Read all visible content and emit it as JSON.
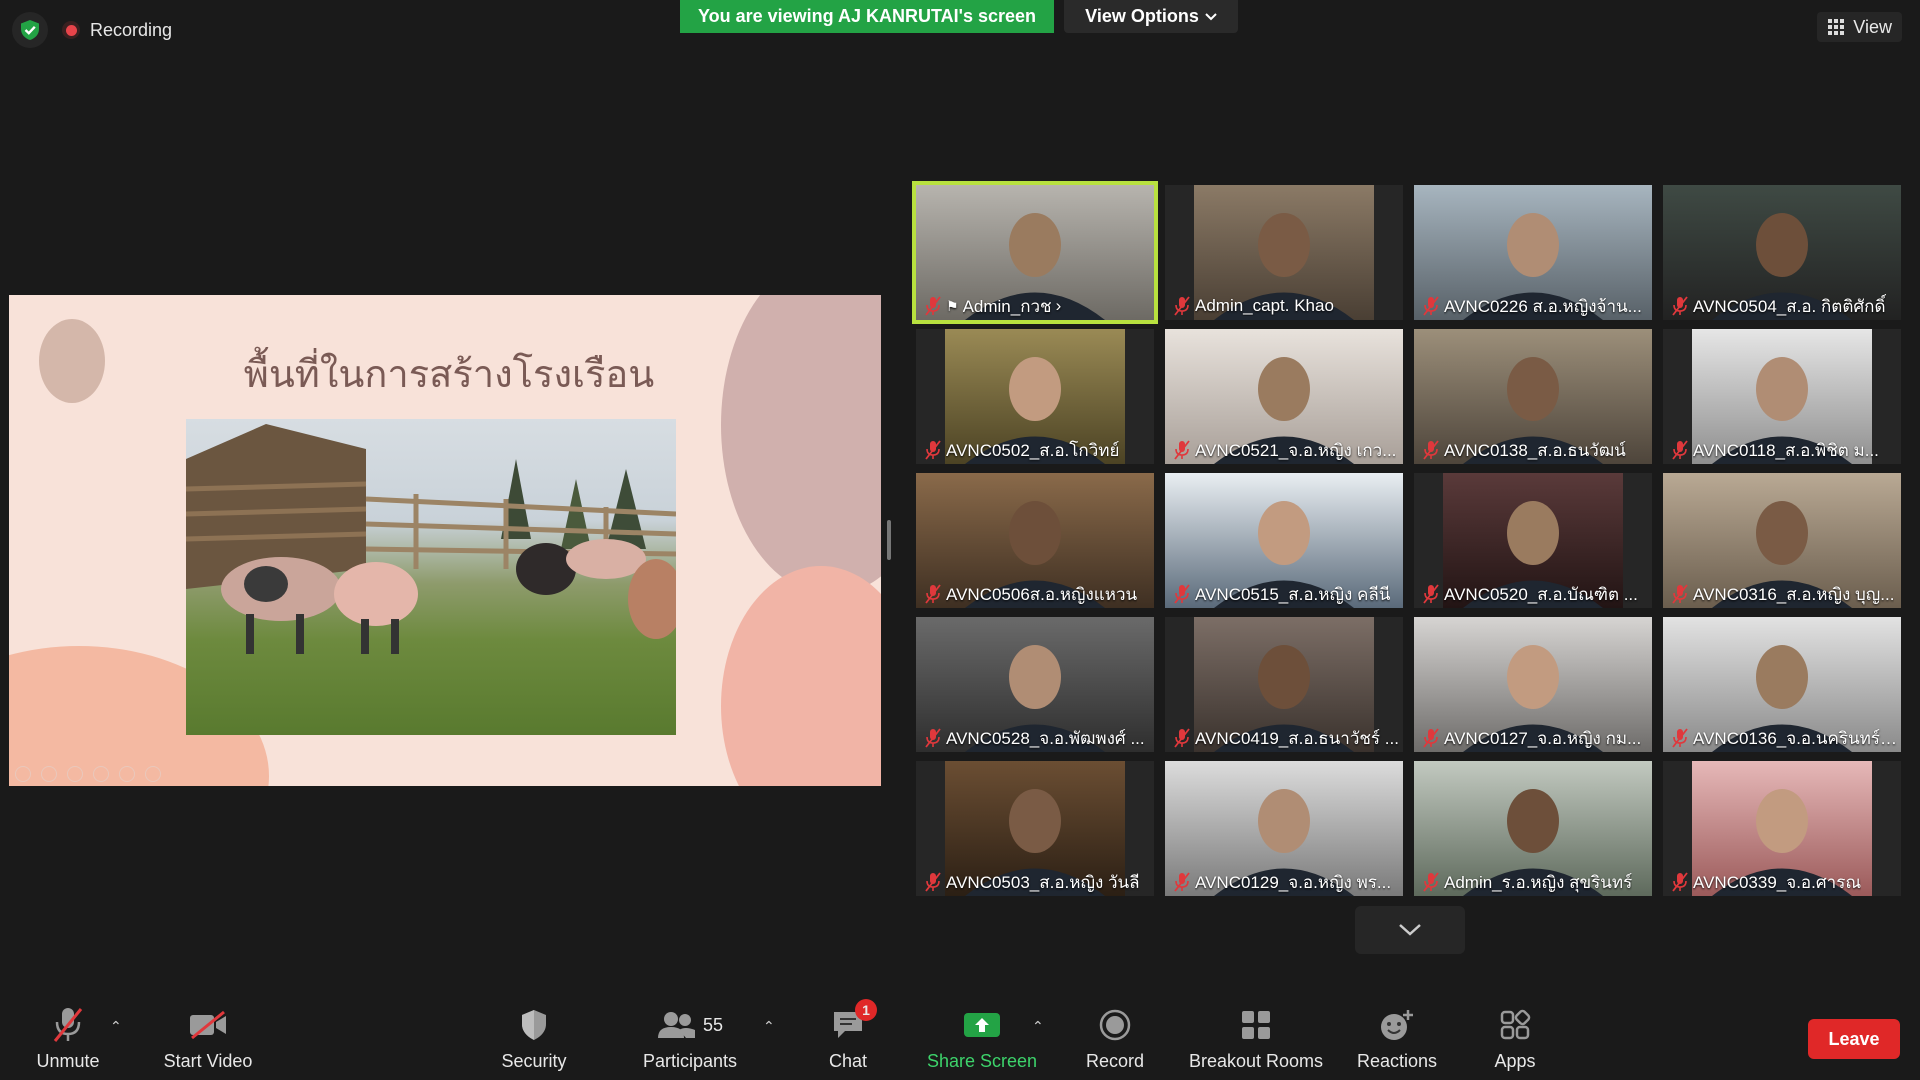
{
  "top": {
    "recording": "Recording",
    "viewing_banner": "You are viewing AJ KANRUTAI's screen",
    "view_options": "View Options",
    "view": "View"
  },
  "slide": {
    "title": "พื้นที่ในการสร้างโรงเรือน"
  },
  "participants_tiles": [
    {
      "name": "Admin_กวช",
      "active": true
    },
    {
      "name": "Admin_capt. Khao"
    },
    {
      "name": "AVNC0226 ส.อ.หญิงจ้าน..."
    },
    {
      "name": "AVNC0504_ส.อ. กิตติศักดิ์"
    },
    {
      "name": "AVNC0502_ส.อ.โกวิทย์"
    },
    {
      "name": "AVNC0521_จ.อ.หญิง เกว..."
    },
    {
      "name": "AVNC0138_ส.อ.ธนวัฒน์"
    },
    {
      "name": "AVNC0118_ส.อ.พิชิต ม..."
    },
    {
      "name": "AVNC0506ส.อ.หญิงแหวน"
    },
    {
      "name": "AVNC0515_ส.อ.หญิง คลีนี"
    },
    {
      "name": "AVNC0520_ส.อ.บัณฑิต  ..."
    },
    {
      "name": "AVNC0316_ส.อ.หญิง บุญ..."
    },
    {
      "name": "AVNC0528_จ.อ.พัฒพงศ์ ..."
    },
    {
      "name": "AVNC0419_ส.อ.ธนาวัชร์ ..."
    },
    {
      "name": "AVNC0127_จ.อ.หญิง กม..."
    },
    {
      "name": "AVNC0136_จ.อ.นครินทร์ ..."
    },
    {
      "name": "AVNC0503_ส.อ.หญิง วันลี"
    },
    {
      "name": "AVNC0129_จ.อ.หญิง พร..."
    },
    {
      "name": "Admin_ร.อ.หญิง สุขรินทร์"
    },
    {
      "name": "AVNC0339_จ.อ.ศารณ"
    }
  ],
  "toolbar": {
    "unmute": "Unmute",
    "start_video": "Start Video",
    "security": "Security",
    "participants": "Participants",
    "participants_count": "55",
    "chat": "Chat",
    "chat_badge": "1",
    "share_screen": "Share Screen",
    "record": "Record",
    "breakout_rooms": "Breakout Rooms",
    "reactions": "Reactions",
    "apps": "Apps",
    "leave": "Leave"
  },
  "colors": {
    "banner_green": "#23a345",
    "active_speaker": "#b8e13f",
    "leave_red": "#e02828",
    "muted_red": "#e0383c"
  }
}
